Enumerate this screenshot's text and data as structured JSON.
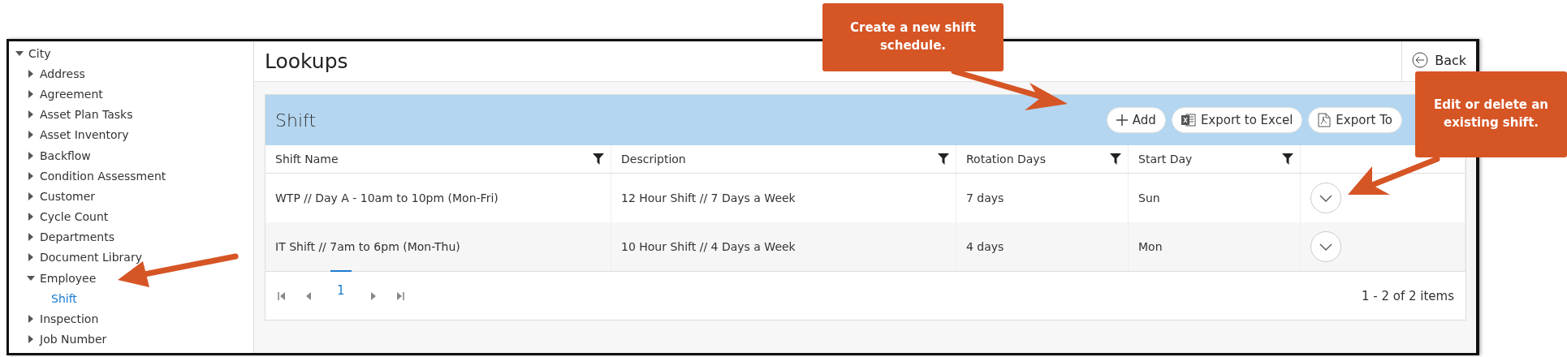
{
  "sidebar": {
    "tree": [
      {
        "label": "City",
        "expanded": true,
        "selected": false,
        "children": [
          {
            "label": "Address",
            "expanded": false,
            "selected": false
          },
          {
            "label": "Agreement",
            "expanded": false,
            "selected": false
          },
          {
            "label": "Asset Plan Tasks",
            "expanded": false,
            "selected": false
          },
          {
            "label": "Asset Inventory",
            "expanded": false,
            "selected": false
          },
          {
            "label": "Backflow",
            "expanded": false,
            "selected": false
          },
          {
            "label": "Condition Assessment",
            "expanded": false,
            "selected": false
          },
          {
            "label": "Customer",
            "expanded": false,
            "selected": false
          },
          {
            "label": "Cycle Count",
            "expanded": false,
            "selected": false
          },
          {
            "label": "Departments",
            "expanded": false,
            "selected": false
          },
          {
            "label": "Document Library",
            "expanded": false,
            "selected": false
          },
          {
            "label": "Employee",
            "expanded": true,
            "selected": false,
            "children": [
              {
                "label": "Shift",
                "selected": true
              }
            ]
          },
          {
            "label": "Inspection",
            "expanded": false,
            "selected": false
          },
          {
            "label": "Job Number",
            "expanded": false,
            "selected": false
          }
        ]
      }
    ]
  },
  "page": {
    "title": "Lookups",
    "back_button": "Back"
  },
  "grid": {
    "title": "Shift",
    "toolbar": [
      {
        "kind": "add",
        "label": "Add"
      },
      {
        "kind": "excel",
        "label": "Export to Excel"
      },
      {
        "kind": "pdf",
        "label": "Export To"
      }
    ],
    "columns": [
      {
        "label": "Shift Name"
      },
      {
        "label": "Description"
      },
      {
        "label": "Rotation Days"
      },
      {
        "label": "Start Day"
      }
    ],
    "rows": [
      {
        "cells": [
          "WTP // Day A - 10am to 10pm (Mon-Fri)",
          "12 Hour Shift // 7 Days a Week",
          "7 days",
          "Sun"
        ]
      },
      {
        "cells": [
          "IT Shift // 7am to 6pm (Mon-Thu)",
          "10 Hour Shift // 4 Days a Week",
          "4 days",
          "Mon"
        ]
      }
    ],
    "pager": {
      "pages": [
        {
          "label": "1",
          "selected": true
        }
      ],
      "summary": "1 - 2 of 2 items"
    }
  },
  "callouts": [
    {
      "text": "Create a new shift schedule."
    },
    {
      "text": "Edit or delete an existing shift."
    }
  ]
}
